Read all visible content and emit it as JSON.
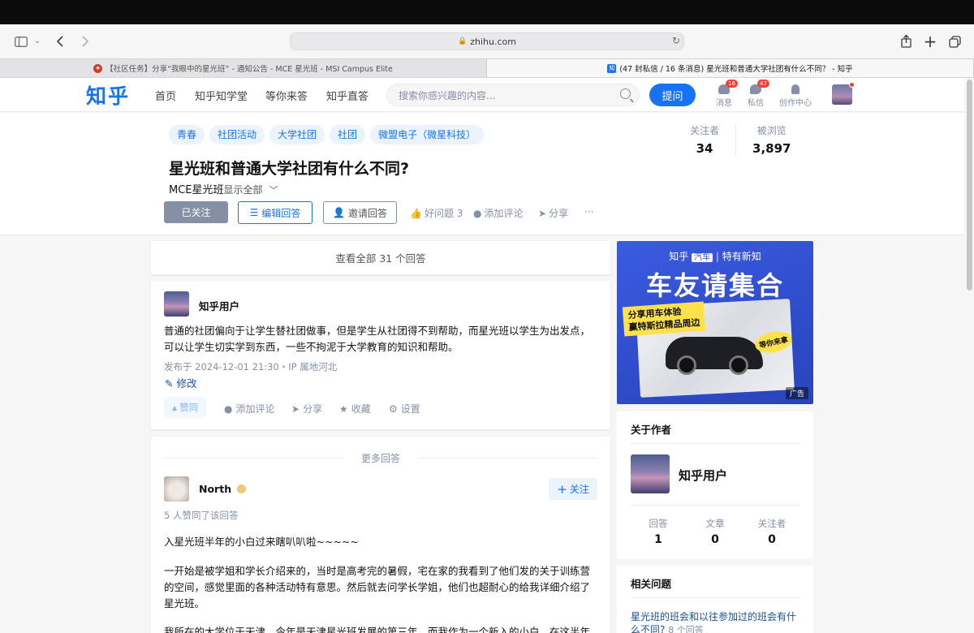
{
  "browser": {
    "url": "zhihu.com",
    "tabs": [
      {
        "label": "【社区任务】分享“我眼中的星光班” - 通知公告 - MCE 星光班 - MSI Campus Elite",
        "favicon": "star-favicon",
        "active": false
      },
      {
        "label": "(47 封私信 / 16 条消息) 星光班和普通大学社团有什么不同？ - 知乎",
        "favicon": "知",
        "active": true
      }
    ]
  },
  "header": {
    "logo": "知乎",
    "nav": [
      "首页",
      "知乎知学堂",
      "等你来答",
      "知乎直答"
    ],
    "search_placeholder": "搜索你感兴趣的内容...",
    "ask_label": "提问",
    "messages": {
      "label": "消息",
      "badge": "16"
    },
    "dm": {
      "label": "私信",
      "badge": "47"
    },
    "creator": {
      "label": "创作中心"
    }
  },
  "question": {
    "topics": [
      "青春",
      "社团活动",
      "大学社团",
      "社团",
      "微盟电子（微星科技）"
    ],
    "title": "星光班和普通大学社团有什么不同?",
    "detail": "MCE星光班",
    "show_all": "显示全部",
    "stats": [
      {
        "label": "关注者",
        "value": "34"
      },
      {
        "label": "被浏览",
        "value": "3,897"
      }
    ],
    "followed_label": "已关注",
    "edit_answer": "编辑回答",
    "invite": "邀请回答",
    "good_question": "好问题 3",
    "add_comment": "添加评论",
    "share": "分享",
    "more": "···"
  },
  "main": {
    "view_all": "查看全部 31 个回答",
    "my_answer": {
      "author": "知乎用户",
      "text": [
        "普通的社团偏向于让学生替社团做事，但是学生从社团得不到帮助，而星光班以学生为出发点，",
        "可以让学生切实学到东西，一些不拘泥于大学教育的知识和帮助。"
      ],
      "meta": "发布于 2024-12-01 21:30・IP 属地河北",
      "edit": "修改",
      "vote": "赞同",
      "actions": [
        "添加评论",
        "分享",
        "收藏",
        "设置"
      ]
    },
    "more_answers": "更多回答",
    "answer2": {
      "author": "North",
      "follow": "关注",
      "likes": "5 人赞同了该回答",
      "para1": "入星光班半年的小白过来瞎叭叭啦~~~~~",
      "para2": [
        "一开始是被学姐和学长介绍来的，当时是高考完的暑假，宅在家的我看到了他们发的关于训练营",
        "的空间，感觉里面的各种活动特有意思。然后就去问学长学姐，他们也超耐心的给我详细介绍了",
        "星光班。"
      ],
      "para3": "我所在的大学位于天津，今年是天津星光班发展的第三年，而我作为一个新入的小白，在这半年"
    }
  },
  "sidebar": {
    "ad": {
      "brand": "知乎",
      "brand_hl": "汽车",
      "tagline": "特有新知",
      "title": "车友请集合",
      "stamp1_line1": "分享用车体验",
      "stamp1_line2": "赢特斯拉精品周边",
      "stamp2": "等你来拿",
      "tag": "广告"
    },
    "author": {
      "title": "关于作者",
      "name": "知乎用户",
      "stats": [
        {
          "label": "回答",
          "value": "1"
        },
        {
          "label": "文章",
          "value": "0"
        },
        {
          "label": "关注者",
          "value": "0"
        }
      ]
    },
    "related": {
      "title": "相关问题",
      "item": "星光班的班会和以往参加过的班会有什么不同?",
      "count": "8 个回答"
    }
  },
  "colors": {
    "brand": "#1772f6",
    "followed": "#8590a6",
    "badge": "#f1403c"
  }
}
